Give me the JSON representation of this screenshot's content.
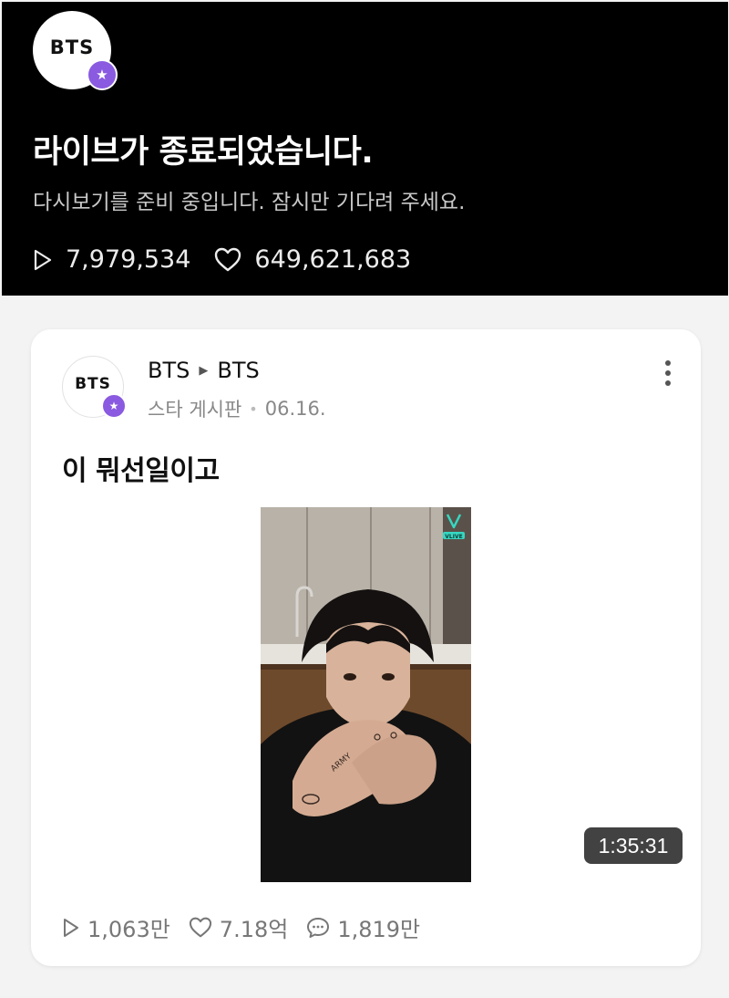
{
  "live": {
    "channel_logo_text": "BTS",
    "title": "라이브가 종료되었습니다.",
    "subtitle": "다시보기를 준비 중입니다. 잠시만 기다려 주세요.",
    "views": "7,979,534",
    "likes": "649,621,683",
    "badge_icon": "star-icon",
    "views_icon": "play-outline-icon",
    "likes_icon": "heart-outline-icon"
  },
  "post": {
    "avatar_text": "BTS",
    "author": "BTS",
    "target": "BTS",
    "board": "스타 게시판",
    "date": "06.16.",
    "text": "이 뭐선일이고",
    "video": {
      "duration": "1:35:31",
      "watermark_label": "VLIVE"
    },
    "stats": {
      "views": "1,063만",
      "likes": "7.18억",
      "comments": "1,819만"
    }
  },
  "colors": {
    "badge_purple": "#8a5ae0",
    "panel_black": "#000000",
    "page_background": "#f3f3f3"
  }
}
